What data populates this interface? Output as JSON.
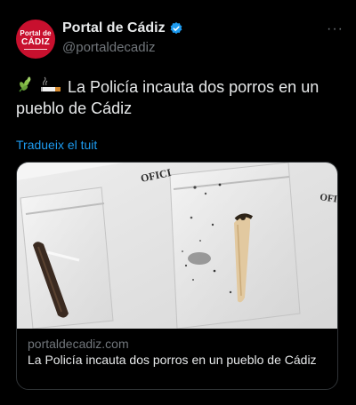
{
  "author": {
    "avatar_line1": "Portal de",
    "avatar_line2": "CÁDIZ",
    "display_name": "Portal de Cádiz",
    "handle": "@portaldecadiz",
    "verified_icon": "verified-badge-icon"
  },
  "more_label": "···",
  "tweet": {
    "text": "La Policía incauta dos porros en un pueblo de Cádiz",
    "emojis": [
      "herb-emoji",
      "cigarette-emoji"
    ]
  },
  "translate_label": "Tradueix el tuit",
  "card": {
    "domain": "portaldecadiz.com",
    "title": "La Policía incauta dos porros en un pueblo de Cádiz",
    "photo_text_left": "OFICI",
    "photo_text_right": "OFI"
  },
  "colors": {
    "background": "#000000",
    "text": "#e7e9ea",
    "secondary": "#71767b",
    "link": "#1d9bf0",
    "avatar": "#c8102e"
  }
}
